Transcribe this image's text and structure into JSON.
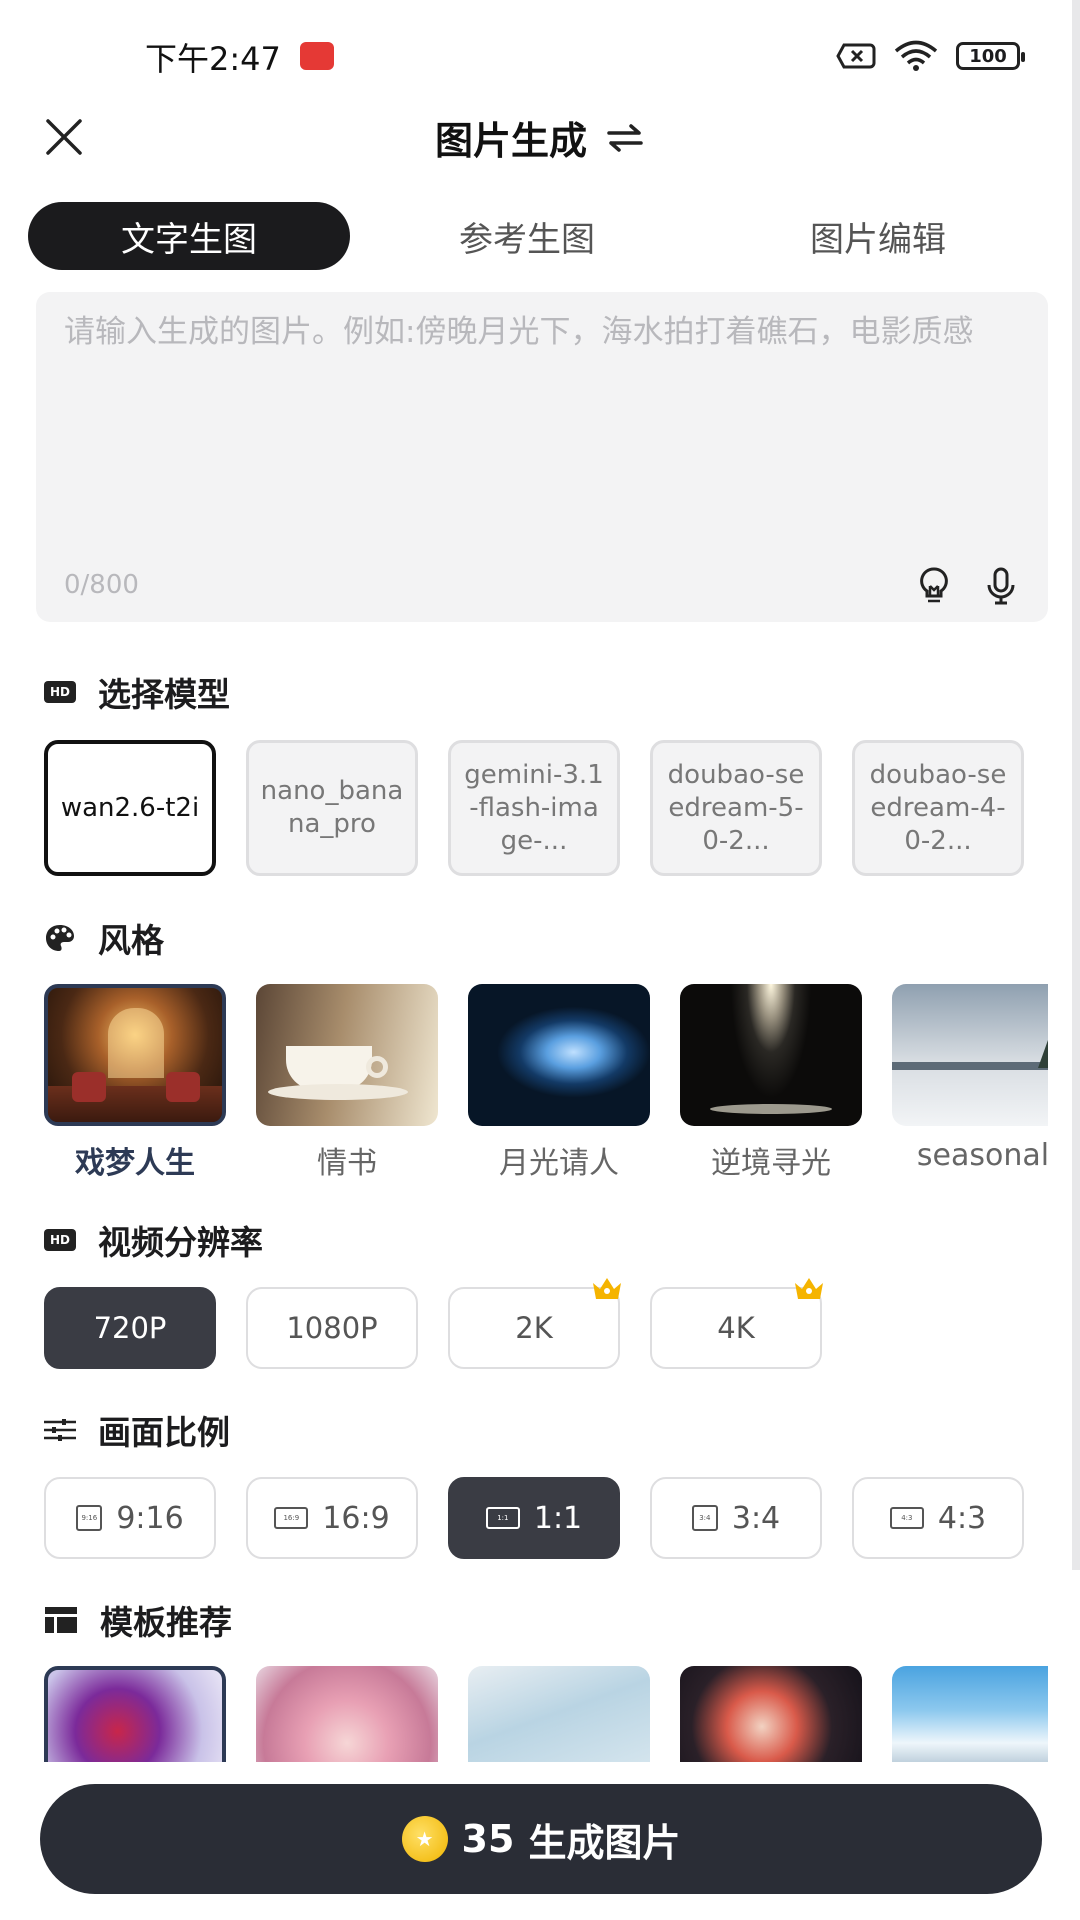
{
  "status_bar": {
    "time": "下午2:47",
    "battery": "100"
  },
  "header": {
    "title": "图片生成"
  },
  "tabs": [
    {
      "label": "文字生图",
      "active": true
    },
    {
      "label": "参考生图",
      "active": false
    },
    {
      "label": "图片编辑",
      "active": false
    }
  ],
  "prompt": {
    "placeholder": "请输入生成的图片。例如:傍晚月光下，海水拍打着礁石，电影质感",
    "counter": "0/800"
  },
  "sections": {
    "model": "选择模型",
    "style": "风格",
    "resolution": "视频分辨率",
    "ratio": "画面比例",
    "templates": "模板推荐"
  },
  "models": [
    {
      "label": "wan2.6-t2i",
      "active": true
    },
    {
      "label": "nano_banana_pro",
      "active": false
    },
    {
      "label": "gemini-3.1-flash-image-...",
      "active": false
    },
    {
      "label": "doubao-seedream-5-0-2...",
      "active": false
    },
    {
      "label": "doubao-seedream-4-0-2...",
      "active": false
    }
  ],
  "styles": [
    {
      "label": "戏梦人生",
      "active": true
    },
    {
      "label": "情书",
      "active": false
    },
    {
      "label": "月光请人",
      "active": false
    },
    {
      "label": "逆境寻光",
      "active": false
    },
    {
      "label": "seasonal",
      "active": false
    }
  ],
  "resolutions": [
    {
      "label": "720P",
      "active": true,
      "premium": false
    },
    {
      "label": "1080P",
      "active": false,
      "premium": false
    },
    {
      "label": "2K",
      "active": false,
      "premium": true
    },
    {
      "label": "4K",
      "active": false,
      "premium": true
    }
  ],
  "ratios": [
    {
      "label": "9:16",
      "icon_text": "9:16",
      "active": false
    },
    {
      "label": "16:9",
      "icon_text": "16:9",
      "active": false
    },
    {
      "label": "1:1",
      "icon_text": "1:1",
      "active": true
    },
    {
      "label": "3:4",
      "icon_text": "3:4",
      "active": false
    },
    {
      "label": "4:3",
      "icon_text": "4:3",
      "active": false
    }
  ],
  "generate": {
    "cost": "35",
    "label": "生成图片"
  },
  "colors": {
    "accent_dark": "#1b1b1d",
    "selected_chip": "#3a3c44",
    "crown": "#f5b400",
    "style_selected": "#2d3a55"
  }
}
